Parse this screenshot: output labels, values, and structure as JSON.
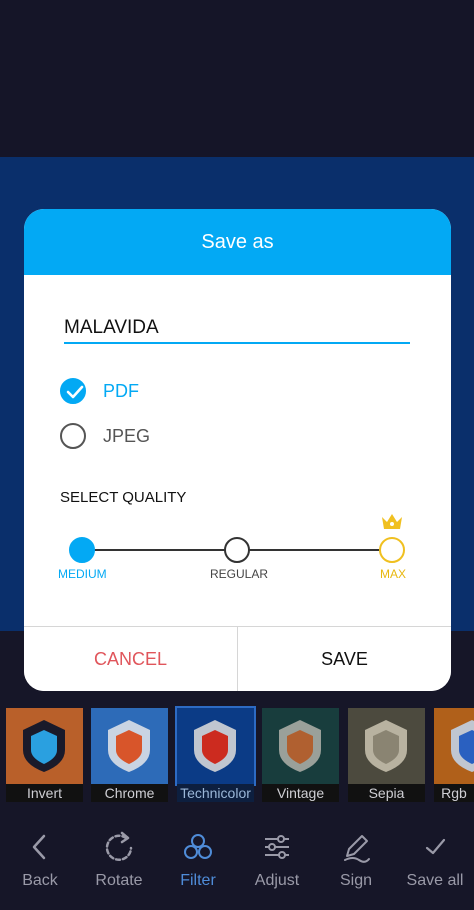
{
  "dialog": {
    "title": "Save as",
    "filename": "MALAVIDA",
    "formats": [
      {
        "label": "PDF",
        "selected": true
      },
      {
        "label": "JPEG",
        "selected": false
      }
    ],
    "quality_title": "SELECT QUALITY",
    "quality_levels": [
      "MEDIUM",
      "REGULAR",
      "MAX"
    ],
    "selected_quality": "MEDIUM",
    "cancel_label": "CANCEL",
    "save_label": "SAVE"
  },
  "filters": [
    "Invert",
    "Chrome",
    "Technicolor",
    "Vintage",
    "Sepia",
    "Rgb"
  ],
  "selected_filter": "Technicolor",
  "toolbar": [
    {
      "label": "Back",
      "icon": "chevron-left-icon"
    },
    {
      "label": "Rotate",
      "icon": "rotate-icon"
    },
    {
      "label": "Filter",
      "icon": "filter-icon"
    },
    {
      "label": "Adjust",
      "icon": "sliders-icon"
    },
    {
      "label": "Sign",
      "icon": "pen-icon"
    },
    {
      "label": "Save all",
      "icon": "check-icon"
    }
  ],
  "colors": {
    "accent": "#03a9f4",
    "cancel": "#e0555b",
    "premium": "#f0c020",
    "backdrop_blue": "#0a2f6b",
    "backdrop_dark": "#161628"
  }
}
